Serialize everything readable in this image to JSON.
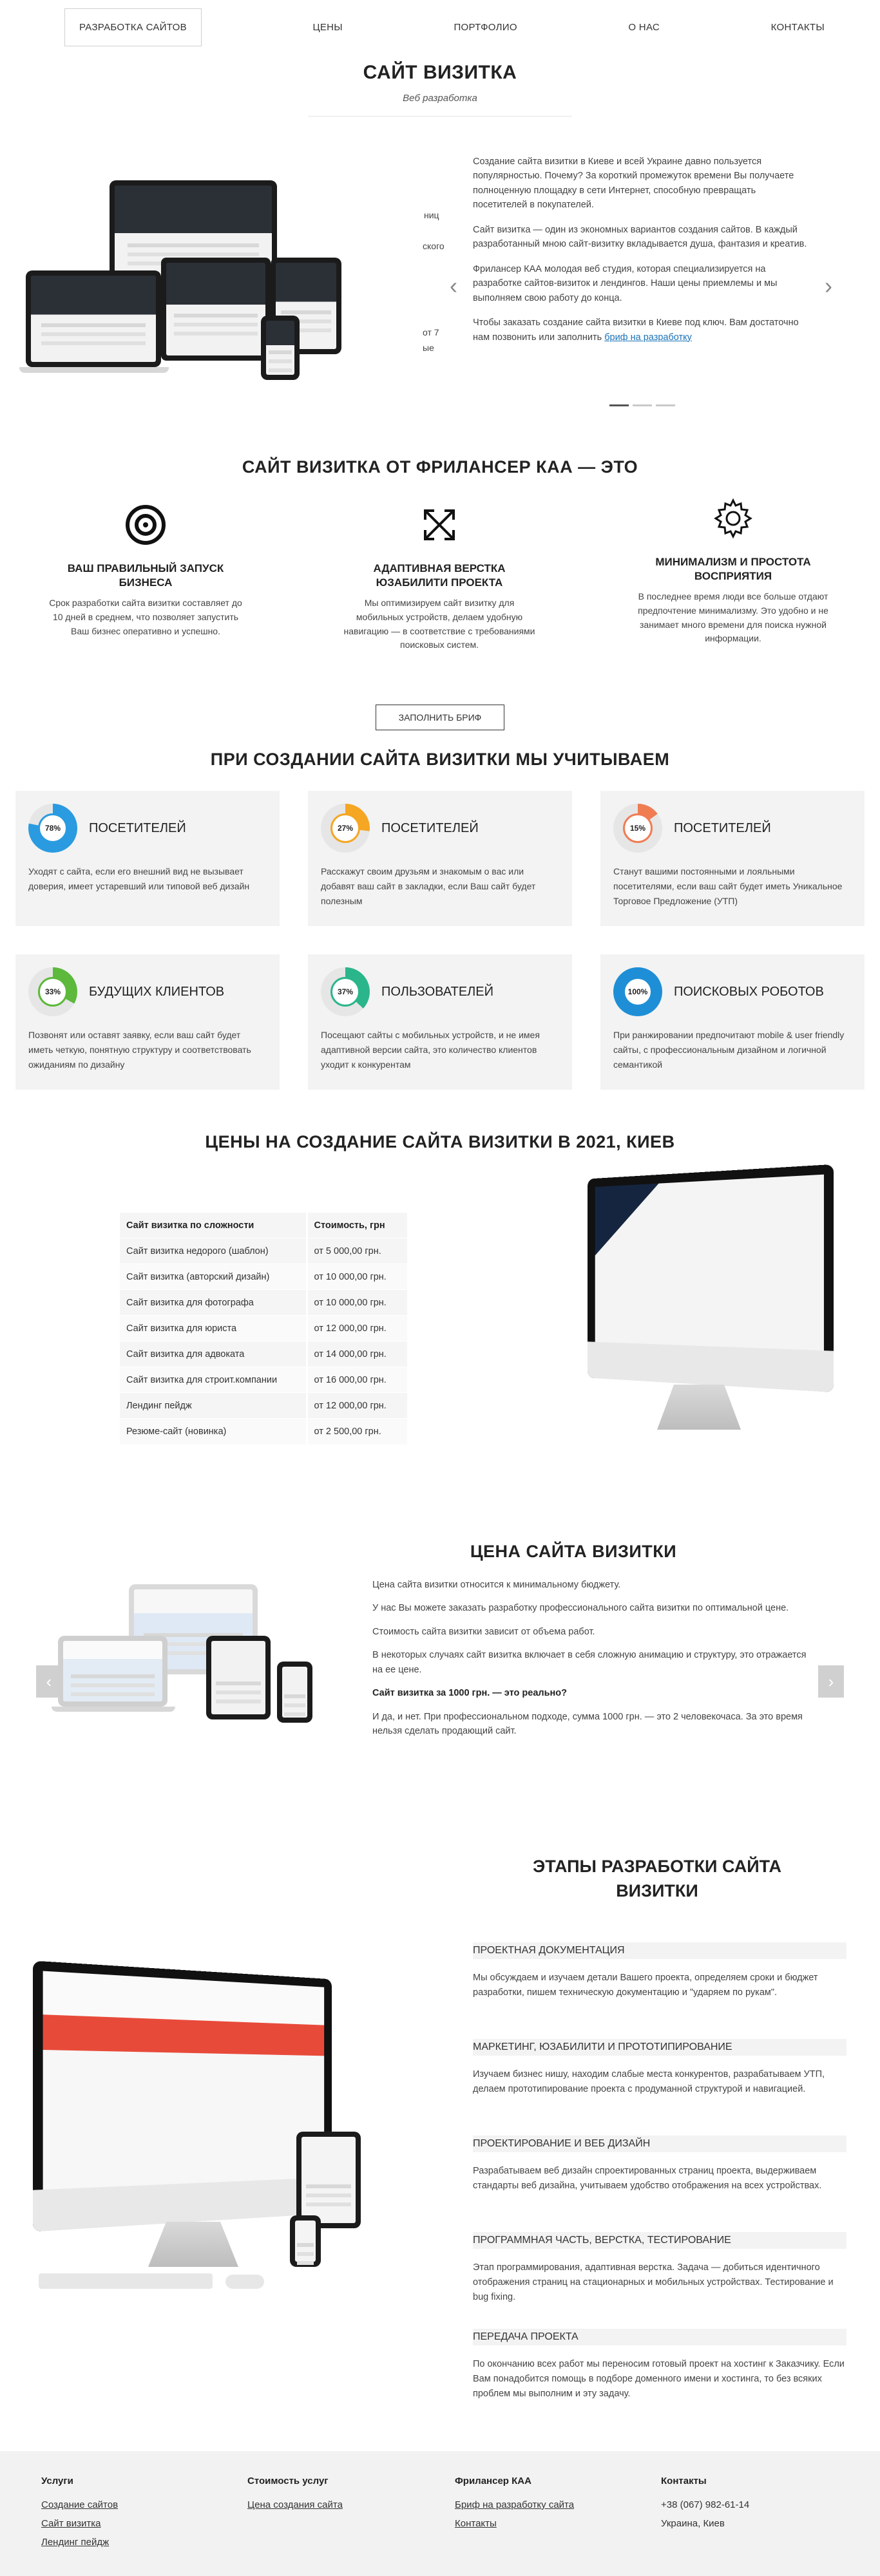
{
  "nav": {
    "items": [
      "Разработка сайтов",
      "Цены",
      "Портфолио",
      "О нас",
      "Контакты"
    ]
  },
  "hero": {
    "title": "САЙТ ВИЗИТКА",
    "subtitle": "Веб разработка",
    "partial_left": [
      "ниц",
      "ского",
      "от 7",
      "ые"
    ],
    "paragraphs": [
      "Создание сайта визитки в Киеве и всей Украине давно пользуется популярностью. Почему? За короткий промежуток времени Вы получаете полноценную площадку в сети Интернет, способную превращать посетителей в покупателей.",
      "Сайт визитка — один из экономных вариантов создания сайтов. В каждый разработанный мною сайт-визитку вкладывается душа, фантазия и креатив.",
      "Фрилансер КАА молодая веб студия, которая специализируется на разработке сайтов-визиток и лендингов. Наши цены приемлемы и мы выполняем свою работу до конца."
    ],
    "last_paragraph": "Чтобы заказать создание сайта визитки в Киеве под ключ. Вам достаточно нам позвонить или заполнить",
    "brief_link": "бриф на разработку",
    "arrow_left": "‹",
    "arrow_right": "›"
  },
  "features_section": {
    "title": "САЙТ ВИЗИТКА ОТ ФРИЛАНСЕР КАА — ЭТО",
    "items": [
      {
        "icon": "target-icon",
        "title": "ВАШ ПРАВИЛЬНЫЙ ЗАПУСК БИЗНЕСА",
        "text": "Срок разработки сайта визитки составляет до 10 дней в среднем, что позволяет запустить Ваш бизнес оперативно и успешно."
      },
      {
        "icon": "expand-arrows-icon",
        "title": "АДАПТИВНАЯ ВЕРСТКА ЮЗАБИЛИТИ ПРОЕКТА",
        "text": "Мы оптимизируем сайт визитку для мобильных устройств, делаем удобную навигацию — в соответствие с требованиями поисковых систем."
      },
      {
        "icon": "gear-icon",
        "title": "МИНИМАЛИЗМ И ПРОСТОТА ВОСПРИЯТИЯ",
        "text": "В последнее время люди все больше отдают предпочтение минимализму. Это удобно и не занимает много времени для поиска нужной информации."
      }
    ],
    "button": "Заполнить бриф"
  },
  "consider_section": {
    "title": "ПРИ СОЗДАНИИ САЙТА ВИЗИТКИ МЫ УЧИТЫВАЕМ",
    "cards": [
      {
        "percent": "78%",
        "fill": 0.78,
        "color": "#2a9be0",
        "title": "ПОСЕТИТЕЛЕЙ",
        "text": "Уходят с сайта, если его внешний вид не вызывает доверия, имеет устаревший или типовой веб дизайн"
      },
      {
        "percent": "27%",
        "fill": 0.27,
        "color": "#f5a623",
        "title": "ПОСЕТИТЕЛЕЙ",
        "text": "Расскажут своим друзьям и знакомым о вас или добавят ваш сайт в закладки, если Ваш сайт будет полезным"
      },
      {
        "percent": "15%",
        "fill": 0.15,
        "color": "#f07c52",
        "title": "ПОСЕТИТЕЛЕЙ",
        "text": "Станут вашими постоянными и лояльными посетителями, если ваш сайт будет иметь Уникальное Торговое Предложение (УТП)"
      },
      {
        "percent": "33%",
        "fill": 0.33,
        "color": "#5cb93c",
        "title": "БУДУЩИХ КЛИЕНТОВ",
        "text": "Позвонят или оставят заявку, если ваш сайт будет иметь четкую, понятную структуру и соответствовать ожиданиям по дизайну"
      },
      {
        "percent": "37%",
        "fill": 0.37,
        "color": "#2bb58a",
        "title": "ПОЛЬЗОВАТЕЛЕЙ",
        "text": "Посещают сайты с мобильных устройств, и не имея адаптивной версии сайта, это количество клиентов уходит к конкурентам"
      },
      {
        "percent": "100%",
        "fill": 1.0,
        "color": "#1e8fd6",
        "title": "ПОИСКОВЫХ РОБОТОВ",
        "text": "При ранжировании предпочитают mobile & user friendly сайты, с профессиональным дизайном и логичной семантикой"
      }
    ]
  },
  "prices_section": {
    "title": "ЦЕНЫ НА СОЗДАНИЕ САЙТА ВИЗИТКИ В 2021, КИЕВ",
    "headers": [
      "Сайт визитка по сложности",
      "Стоимость, грн"
    ],
    "rows": [
      [
        "Сайт визитка недорого (шаблон)",
        "от 5 000,00 грн."
      ],
      [
        "Сайт визитка (авторский дизайн)",
        "от 10 000,00 грн."
      ],
      [
        "Сайт визитка для фотографа",
        "от 10 000,00 грн."
      ],
      [
        "Сайт визитка для юриста",
        "от 12 000,00 грн."
      ],
      [
        "Сайт визитка для адвоката",
        "от 14 000,00 грн."
      ],
      [
        "Сайт визитка для строит.компании",
        "от 16 000,00 грн."
      ],
      [
        "Лендинг пейдж",
        "от 12 000,00 грн."
      ],
      [
        "Резюме-сайт (новинка)",
        "от 2 500,00 грн."
      ]
    ]
  },
  "price_text_section": {
    "title": "ЦЕНА САЙТА ВИЗИТКИ",
    "paragraphs": [
      "Цена сайта визитки относится к минимальному бюджету.",
      "У нас Вы можете заказать разработку профессионального сайта визитки по оптимальной цене.",
      "Стоимость сайта визитки зависит от объема работ.",
      "В некоторых случаях сайт визитка включает в себя сложную анимацию и структуру, это отражается на ее цене."
    ],
    "question": "Сайт визитка за 1000 грн. — это реально?",
    "answer": "И да, и нет. При профессиональном подходе, сумма 1000 грн. — это 2 человекочаса. За это время нельзя сделать продающий сайт.",
    "arrow_left": "‹",
    "arrow_right": "›"
  },
  "stages_section": {
    "title": "ЭТАПЫ РАЗРАБОТКИ САЙТА ВИЗИТКИ",
    "stages": [
      {
        "title": "ПРОЕКТНАЯ ДОКУМЕНТАЦИЯ",
        "text": "Мы обсуждаем и изучаем детали Вашего проекта, определяем сроки и бюджет разработки, пишем техническую документацию и \"ударяем по рукам\"."
      },
      {
        "title": "МАРКЕТИНГ, ЮЗАБИЛИТИ И ПРОТОТИПИРОВАНИЕ",
        "text": "Изучаем бизнес нишу, находим слабые места конкурентов, разрабатываем УТП, делаем прототипирование проекта с продуманной структурой и навигацией."
      },
      {
        "title": "ПРОЕКТИРОВАНИЕ И ВЕБ ДИЗАЙН",
        "text": "Разрабатываем веб дизайн спроектированных страниц проекта, выдерживаем стандарты веб дизайна, учитываем удобство отображения на всех устройствах."
      },
      {
        "title": "ПРОГРАММНАЯ ЧАСТЬ, ВЕРСТКА, ТЕСТИРОВАНИЕ",
        "text": "Этап программирования, адаптивная верстка. Задача — добиться идентичного отображения страниц на стационарных и мобильных устройствах. Тестирование и bug fixing."
      },
      {
        "title": "ПЕРЕДАЧА ПРОЕКТА",
        "text": "По окончанию всех работ мы переносим готовый проект на хостинг к Заказчику. Если Вам понадобится помощь в подборе доменного имени и хостинга, то без всяких проблем мы выполним и эту задачу."
      }
    ]
  },
  "footer": {
    "columns": [
      {
        "title": "Услуги",
        "links": [
          "Создание сайтов",
          "Сайт визитка",
          "Лендинг пейдж"
        ]
      },
      {
        "title": "Стоимость услуг",
        "links": [
          "Цена создания сайта"
        ]
      },
      {
        "title": "Фрилансер КАА",
        "links": [
          "Бриф на разработку сайта",
          "Контакты"
        ]
      },
      {
        "title": "Контакты",
        "texts": [
          "+38 (067) 982-61-14",
          "Украина, Киев"
        ]
      }
    ]
  },
  "colors": {
    "link": "#1a73b8",
    "card_bg": "#f3f3f3",
    "footer_bg": "#f2f2f2"
  }
}
